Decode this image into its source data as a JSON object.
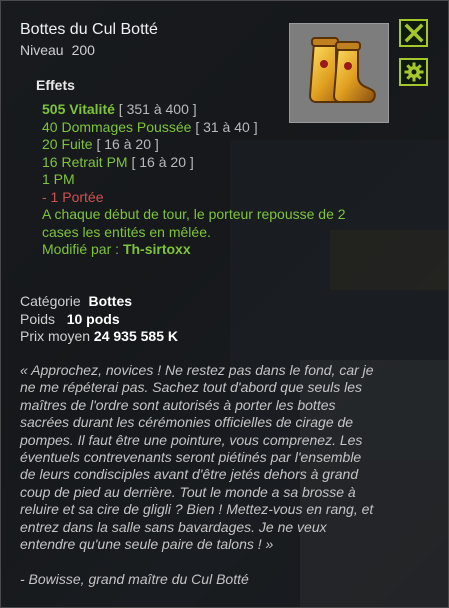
{
  "item": {
    "name": "Bottes du Cul Botté",
    "level_label": "Niveau",
    "level_value": "200"
  },
  "buttons": {
    "close_icon": "close-icon",
    "settings_icon": "gear-icon"
  },
  "effects": {
    "heading": "Effets",
    "lines": [
      {
        "text": "505 Vitalité",
        "range": "[ 351 à 400 ]"
      },
      {
        "text": "40 Dommages Poussée",
        "range": "[ 31 à 40 ]"
      },
      {
        "text": "20 Fuite",
        "range": "[ 16 à 20 ]"
      },
      {
        "text": "16 Retrait PM",
        "range": "[ 16 à 20 ]"
      },
      {
        "text": "1 PM",
        "range": ""
      },
      {
        "text": "- 1 Portée",
        "range": ""
      }
    ],
    "special": "A chaque début de tour, le porteur repousse de 2 cases les entités en mêlée.",
    "modified_label": "Modifié par :",
    "modified_by": "Th-sirtoxx"
  },
  "properties": {
    "category_label": "Catégorie",
    "category_value": "Bottes",
    "weight_label": "Poids",
    "weight_value": "10 pods",
    "price_label": "Prix moyen",
    "price_value": "24 935 585 K"
  },
  "description": {
    "quote": "« Approchez, novices ! Ne restez pas dans le fond, car je ne me répéterai pas. Sachez tout d'abord que seuls les maîtres de l'ordre sont autorisés à porter les bottes sacrées durant les cérémonies officielles de cirage de pompes. Il faut être une pointure, vous comprenez. Les éventuels contrevenants seront piétinés par l'ensemble de leurs condisciples avant d'être jetés dehors à grand coup de pied au derrière. Tout le monde a sa brosse à reluire et sa cire de gligli ? Bien ! Mettez-vous en rang, et entrez dans la salle sans bavardages. Je ne veux entendre qu'une seule paire de talons ! »",
    "author": "- Bowisse, grand maître du Cul Botté"
  },
  "colors": {
    "effect_positive": "#7ec43b",
    "effect_negative": "#d05050",
    "button_border": "#a4c72a"
  }
}
